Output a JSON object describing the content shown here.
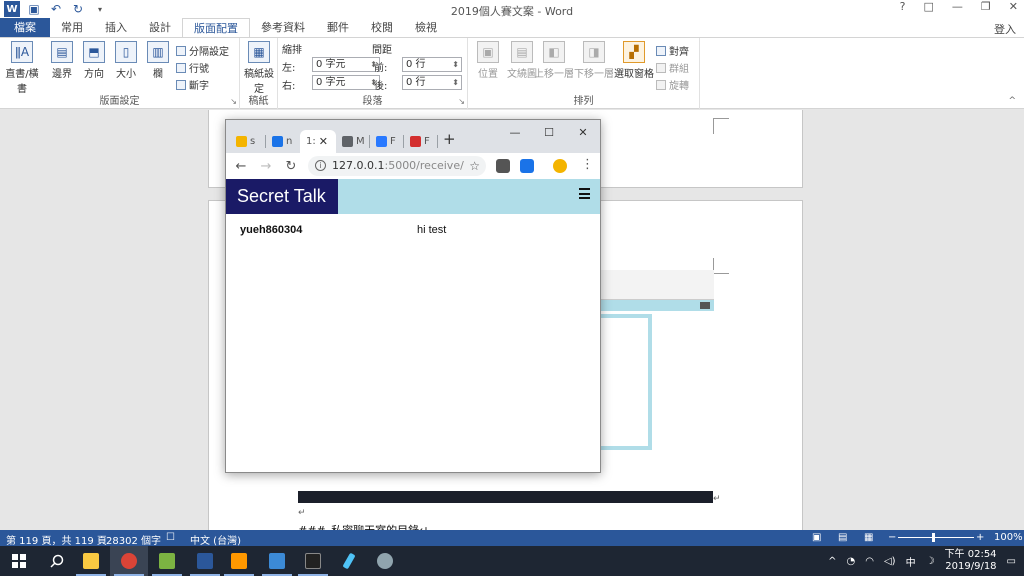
{
  "word": {
    "title": "2019個人賽文案 - Word",
    "title_controls": [
      "?",
      "□",
      "—",
      "❐",
      "✕"
    ],
    "sign_in": "登入",
    "tabs": [
      "檔案",
      "常用",
      "插入",
      "設計",
      "版面配置",
      "參考資料",
      "郵件",
      "校閱",
      "檢視"
    ],
    "ribbon": {
      "page_setup": {
        "label": "版面設定",
        "text_direction": "直書/橫書",
        "margins": "邊界",
        "orientation": "方向",
        "size": "大小",
        "columns": "欄",
        "breaks": "分隔設定",
        "line_numbers": "行號",
        "hyphenation": "斷字"
      },
      "paper": {
        "label": "稿紙",
        "btn": "稿紙設定"
      },
      "paragraph": {
        "label": "段落",
        "indent_header": "縮排",
        "spacing_header": "間距",
        "left_label": "左:",
        "left_value": "0 字元",
        "right_label": "右:",
        "right_value": "0 字元",
        "before_label": "前:",
        "before_value": "0 行",
        "after_label": "後:",
        "after_value": "0 行"
      },
      "arrange": {
        "label": "排列",
        "position": "位置",
        "wrap": "文繞圖",
        "forward": "上移一層",
        "backward": "下移一層",
        "pane": "選取窗格",
        "align": "對齊",
        "group": "群組",
        "rotate": "旋轉"
      }
    },
    "doc": {
      "return_mark": "↵",
      "line_text": "###_私密聊天室的目錄↵"
    },
    "status": {
      "page": "第 119 頁，共 119 頁",
      "words": "28302 個字",
      "language": "中文 (台灣)",
      "zoom": "100%",
      "zoom_minus": "−",
      "zoom_plus": "+"
    }
  },
  "chrome": {
    "tabs": [
      {
        "label": "s",
        "color": "#f4b400"
      },
      {
        "label": "n",
        "color": "#1a73e8"
      },
      {
        "label": "1:",
        "color": "#9e9e9e"
      },
      {
        "label": "M",
        "color": "#5f6368"
      },
      {
        "label": "F",
        "color": "#2979ff"
      },
      {
        "label": "F",
        "color": "#d32f2f"
      }
    ],
    "new_tab": "+",
    "win_controls": [
      "—",
      "☐",
      "✕"
    ],
    "address": {
      "host": "127.0.0.1",
      "path": ":5000/receive/"
    },
    "info": "i",
    "star": "☆",
    "menu": "⋮",
    "back": "←",
    "forward": "→",
    "reload": "↻",
    "extensions": [
      "#555555",
      "#1a73e8",
      "#f4b400"
    ],
    "tab_close": "✕"
  },
  "site": {
    "brand": "Secret Talk",
    "messages": [
      {
        "user": "yueh860304",
        "text": "hi test"
      }
    ]
  },
  "taskbar": {
    "time": "下午 02:54",
    "date": "2019/9/18",
    "apps": [
      {
        "name": "file-explorer",
        "color": "#f9c942"
      },
      {
        "name": "chrome",
        "color": "#db4437"
      },
      {
        "name": "notepad-plus-plus",
        "color": "#7cb342"
      },
      {
        "name": "word",
        "color": "#2b579a"
      },
      {
        "name": "sublime-text",
        "color": "#ff9800"
      },
      {
        "name": "vscode",
        "color": "#3c8ad6"
      },
      {
        "name": "terminal",
        "color": "#222222"
      },
      {
        "name": "pen-app",
        "color": "#4fc3f7"
      },
      {
        "name": "paint",
        "color": "#90a4ae"
      }
    ]
  },
  "colors": {
    "word_blue": "#2b579a",
    "nav_bg": "#b0dde8",
    "brand_bg": "#1a1a66"
  }
}
